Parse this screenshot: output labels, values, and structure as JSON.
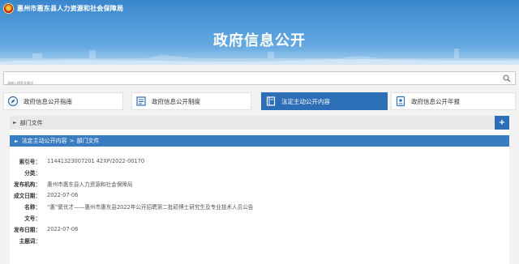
{
  "header": {
    "org_name": "惠州市惠东县人力资源和社会保障局",
    "title": "政府信息公开",
    "emblem_icon": "national-emblem-icon",
    "colors": {
      "banner_top": "#3a86cd",
      "banner_bottom": "#7bb6e6"
    }
  },
  "search": {
    "placeholder": "请输入搜索关键词",
    "icon": "search-icon"
  },
  "tabs": [
    {
      "label": "政府信息公开指南",
      "icon": "compass-icon",
      "active": false
    },
    {
      "label": "政府信息公开制度",
      "icon": "document-list-icon",
      "active": false
    },
    {
      "label": "法定主动公开内容",
      "icon": "book-icon",
      "active": true
    },
    {
      "label": "政府信息公开年报",
      "icon": "report-icon",
      "active": false
    }
  ],
  "section": {
    "dept_label": "部门文件",
    "expand_symbol": "+",
    "breadcrumb": [
      "法定主动公开内容",
      "部门文件"
    ],
    "breadcrumb_sep": ">"
  },
  "info": {
    "rows": [
      {
        "key": "索引号：",
        "value": "11441323007201 42XP/2022-00170"
      },
      {
        "key": "分类：",
        "value": ""
      },
      {
        "key": "发布机构：",
        "value": "惠州市惠东县人力资源和社会保障局"
      },
      {
        "key": "成文日期：",
        "value": "2022-07-06"
      },
      {
        "key": "名称：",
        "value": "“惠”聚优才——惠州市惠东县2022年公开招聘第二批硕博士研究生及专业技术人员公告"
      },
      {
        "key": "文号：",
        "value": ""
      },
      {
        "key": "发布日期：",
        "value": "2022-07-06"
      },
      {
        "key": "主题词：",
        "value": ""
      }
    ]
  },
  "accent_color": "#2d6fb7"
}
